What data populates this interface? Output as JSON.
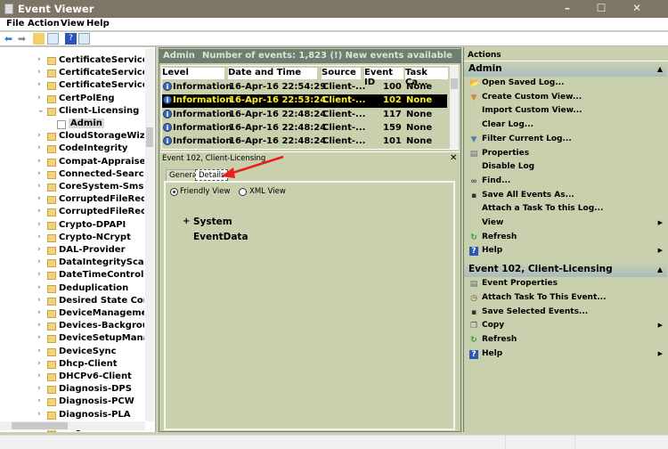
{
  "window": {
    "title": "Event Viewer",
    "controls": [
      "–",
      "☐",
      "✕"
    ]
  },
  "menu": [
    "File",
    "Action",
    "View",
    "Help"
  ],
  "toolbar": [
    "back-icon",
    "forward-icon",
    "up-folder-icon",
    "show-hide-tree-icon",
    "help-icon",
    "show-hide-action-pane-icon"
  ],
  "tree": {
    "items": [
      {
        "label": "CertificateServicesClie",
        "expanded": false
      },
      {
        "label": "CertificateServicesClie",
        "expanded": false
      },
      {
        "label": "CertificateServicesClie",
        "expanded": false
      },
      {
        "label": "CertPolEng",
        "expanded": false
      },
      {
        "label": "Client-Licensing",
        "expanded": true
      },
      {
        "label": "Admin",
        "child": true,
        "selected": true
      },
      {
        "label": "CloudStorageWizard",
        "expanded": false
      },
      {
        "label": "CodeIntegrity",
        "expanded": false
      },
      {
        "label": "Compat-Appraiser"
      },
      {
        "label": "Connected-Search"
      },
      {
        "label": "CoreSystem-SmsRout"
      },
      {
        "label": "CorruptedFileRecover"
      },
      {
        "label": "CorruptedFileRecover"
      },
      {
        "label": "Crypto-DPAPI"
      },
      {
        "label": "Crypto-NCrypt"
      },
      {
        "label": "DAL-Provider"
      },
      {
        "label": "DataIntegrityScan"
      },
      {
        "label": "DateTimeControlPane"
      },
      {
        "label": "Deduplication"
      },
      {
        "label": "Desired State Configu"
      },
      {
        "label": "DeviceManagement-E"
      },
      {
        "label": "Devices-Background"
      },
      {
        "label": "DeviceSetupManager"
      },
      {
        "label": "DeviceSync"
      },
      {
        "label": "Dhcp-Client"
      },
      {
        "label": "DHCPv6-Client"
      },
      {
        "label": "Diagnosis-DPS"
      },
      {
        "label": "Diagnosis-PCW"
      },
      {
        "label": "Diagnosis-PLA"
      },
      {
        "label": "Diagnosis-Scheduled"
      }
    ]
  },
  "log": {
    "name": "Admin",
    "summary": "Number of events: 1,823 (!) New events available"
  },
  "table": {
    "columns": [
      "Level",
      "Date and Time",
      "Source",
      "Event ID",
      "Task Ca..."
    ],
    "rows": [
      {
        "level": "Information",
        "date": "16-Apr-16 22:54:29",
        "source": "Client-...",
        "id": "100",
        "task": "None",
        "selected": false
      },
      {
        "level": "Information",
        "date": "16-Apr-16 22:53:24",
        "source": "Client-...",
        "id": "102",
        "task": "None",
        "selected": true
      },
      {
        "level": "Information",
        "date": "16-Apr-16 22:48:24",
        "source": "Client-...",
        "id": "117",
        "task": "None",
        "selected": false
      },
      {
        "level": "Information",
        "date": "16-Apr-16 22:48:24",
        "source": "Client-...",
        "id": "159",
        "task": "None",
        "selected": false
      },
      {
        "level": "Information",
        "date": "16-Apr-16 22:48:24",
        "source": "Client-...",
        "id": "101",
        "task": "None",
        "selected": false
      }
    ]
  },
  "detail": {
    "title": "Event 102, Client-Licensing",
    "close": "✕",
    "tabs": [
      "General",
      "Details"
    ],
    "active_tab": "Details",
    "views": [
      "Friendly View",
      "XML View"
    ],
    "selected_view": "Friendly View",
    "tree": [
      {
        "expander": "+",
        "label": "System"
      },
      {
        "expander": "",
        "label": "EventData"
      }
    ]
  },
  "annotation": {
    "color": "#e8201c",
    "target": "Details tab"
  },
  "actions": {
    "title": "Actions",
    "sections": [
      {
        "title": "Admin",
        "items": [
          {
            "label": "Open Saved Log...",
            "icon": "open-log-icon"
          },
          {
            "label": "Create Custom View...",
            "icon": "filter-new-icon"
          },
          {
            "label": "Import Custom View...",
            "icon": ""
          },
          {
            "label": "Clear Log...",
            "icon": ""
          },
          {
            "label": "Filter Current Log...",
            "icon": "filter-icon"
          },
          {
            "label": "Properties",
            "icon": "properties-icon"
          },
          {
            "label": "Disable Log",
            "icon": ""
          },
          {
            "label": "Find...",
            "icon": "binoculars-icon"
          },
          {
            "label": "Save All Events As...",
            "icon": "save-icon"
          },
          {
            "label": "Attach a Task To this Log...",
            "icon": ""
          },
          {
            "label": "View",
            "icon": "",
            "submenu": true
          },
          {
            "label": "Refresh",
            "icon": "refresh-icon"
          },
          {
            "label": "Help",
            "icon": "help-icon",
            "submenu": true
          }
        ]
      },
      {
        "title": "Event 102, Client-Licensing",
        "items": [
          {
            "label": "Event Properties",
            "icon": "properties-icon"
          },
          {
            "label": "Attach Task To This Event...",
            "icon": "task-icon"
          },
          {
            "label": "Save Selected Events...",
            "icon": "save-icon"
          },
          {
            "label": "Copy",
            "icon": "copy-icon",
            "submenu": true
          },
          {
            "label": "Refresh",
            "icon": "refresh-icon"
          },
          {
            "label": "Help",
            "icon": "help-icon",
            "submenu": true
          }
        ]
      }
    ]
  },
  "colors": {
    "titlebar": "#7d7566",
    "pane_bg": "#c9d0ae",
    "header_bar": "#6e7e73",
    "selected_row_text": "#ffef2a"
  }
}
